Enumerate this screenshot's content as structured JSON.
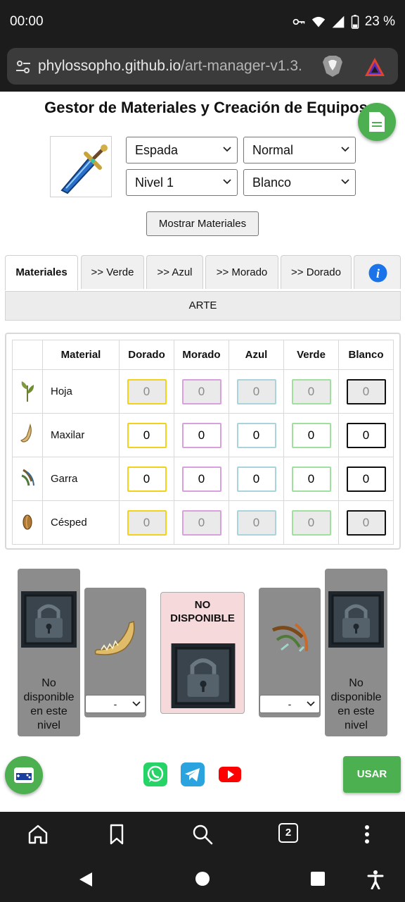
{
  "status_bar": {
    "time": "00:00",
    "battery": "23 %"
  },
  "browser": {
    "url_host": "phylossopho.github.io",
    "url_path": "/art-manager-v1.3.",
    "tab_count": "2"
  },
  "page": {
    "title": "Gestor de Materiales y Creación de Equipos",
    "selects": {
      "item_type": "Espada",
      "quality": "Normal",
      "level": "Nivel 1",
      "color": "Blanco"
    },
    "show_button": "Mostrar Materiales",
    "tabs": [
      {
        "label": "Materiales"
      },
      {
        "label": ">> Verde"
      },
      {
        "label": ">> Azul"
      },
      {
        "label": ">> Morado"
      },
      {
        "label": ">> Dorado"
      }
    ],
    "section_label": "ARTE",
    "table": {
      "headers": [
        "Material",
        "Dorado",
        "Morado",
        "Azul",
        "Verde",
        "Blanco"
      ],
      "rows": [
        {
          "name": "Hoja",
          "values": [
            "0",
            "0",
            "0",
            "0",
            "0"
          ],
          "enabled": false
        },
        {
          "name": "Maxilar",
          "values": [
            "0",
            "0",
            "0",
            "0",
            "0"
          ],
          "enabled": true
        },
        {
          "name": "Garra",
          "values": [
            "0",
            "0",
            "0",
            "0",
            "0"
          ],
          "enabled": true
        },
        {
          "name": "Césped",
          "values": [
            "0",
            "0",
            "0",
            "0",
            "0"
          ],
          "enabled": false
        }
      ],
      "column_colors": [
        "#f2d21a",
        "#d8a0dc",
        "#a9d4dc",
        "#9fe09f",
        "#111111"
      ]
    },
    "slots": {
      "left_outer_text": "No disponible en este nivel",
      "right_outer_text": "No disponible en este nivel",
      "left_select": "-",
      "right_select": "-",
      "center_title": "NO DISPONIBLE"
    },
    "use_button": "USAR"
  },
  "colors": {
    "accent_green": "#4caf50",
    "info_blue": "#1a73e8",
    "dark_chrome": "#1c1c1c"
  }
}
